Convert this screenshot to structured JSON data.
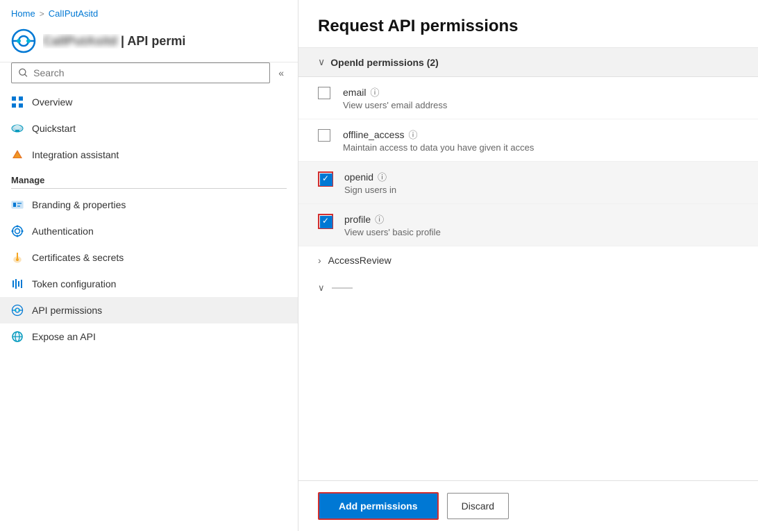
{
  "breadcrumb": {
    "home": "Home",
    "separator": ">",
    "current": "CalIPutAsitd"
  },
  "app": {
    "title": "CalIPutAsitd | API permi",
    "truncated_title": "CalIPutAsitd"
  },
  "search": {
    "placeholder": "Search",
    "label": "Search"
  },
  "nav": {
    "overview": "Overview",
    "quickstart": "Quickstart",
    "integration": "Integration assistant",
    "manage_header": "Manage",
    "branding": "Branding & properties",
    "authentication": "Authentication",
    "certificates": "Certificates & secrets",
    "token": "Token configuration",
    "api_permissions": "API permissions",
    "expose_api": "Expose an API"
  },
  "panel": {
    "title": "Request API permissions",
    "openid_section": "OpenId permissions (2)",
    "email_name": "email",
    "email_desc": "View users' email address",
    "offline_name": "offline_access",
    "offline_desc": "Maintain access to data you have given it acces",
    "openid_name": "openid",
    "openid_desc": "Sign users in",
    "profile_name": "profile",
    "profile_desc": "View users' basic profile",
    "access_review": "AccessReview",
    "add_permissions": "Add permissions",
    "discard": "Discard"
  }
}
